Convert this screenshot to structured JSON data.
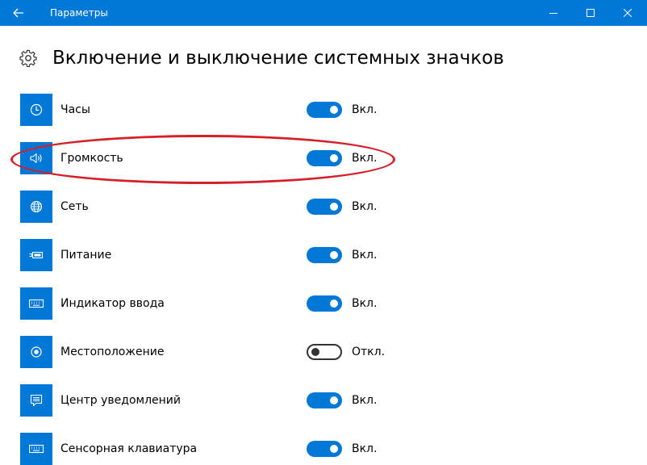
{
  "window": {
    "title": "Параметры",
    "accent": "#0078d7",
    "back_icon": "arrow-left-icon",
    "controls": [
      "minimize-icon",
      "maximize-icon",
      "close-icon"
    ]
  },
  "page": {
    "header_icon": "gear-icon",
    "title": "Включение и выключение системных значков"
  },
  "items": [
    {
      "icon": "clock-icon",
      "label": "Часы",
      "on": true,
      "state": "Вкл."
    },
    {
      "icon": "speaker-icon",
      "label": "Громкость",
      "on": true,
      "state": "Вкл."
    },
    {
      "icon": "globe-icon",
      "label": "Сеть",
      "on": true,
      "state": "Вкл."
    },
    {
      "icon": "battery-icon",
      "label": "Питание",
      "on": true,
      "state": "Вкл."
    },
    {
      "icon": "keyboard-icon",
      "label": "Индикатор ввода",
      "on": true,
      "state": "Вкл."
    },
    {
      "icon": "location-icon",
      "label": "Местоположение",
      "on": false,
      "state": "Откл."
    },
    {
      "icon": "action-center-icon",
      "label": "Центр уведомлений",
      "on": true,
      "state": "Вкл."
    },
    {
      "icon": "keyboard-icon",
      "label": "Сенсорная клавиатура",
      "on": true,
      "state": "Вкл."
    }
  ],
  "annotation": {
    "color": "#d42029",
    "highlighted_item": "Громкость"
  }
}
